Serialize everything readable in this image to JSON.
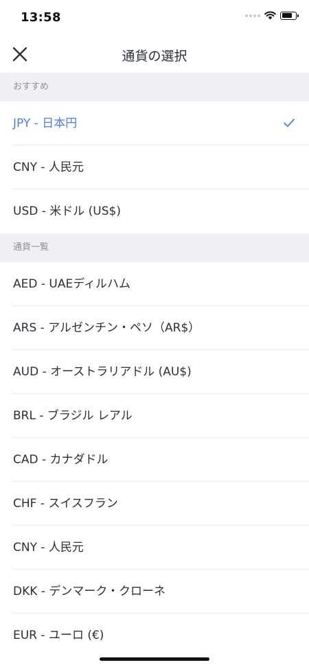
{
  "status_bar": {
    "time": "13:58",
    "battery_level": 0.8
  },
  "header": {
    "title": "通貨の選択",
    "close_icon": "close-icon"
  },
  "sections": [
    {
      "title": "おすすめ",
      "items": [
        {
          "label": "JPY - 日本円",
          "selected": true
        },
        {
          "label": "CNY - 人民元",
          "selected": false
        },
        {
          "label": "USD - 米ドル (US$)",
          "selected": false
        }
      ]
    },
    {
      "title": "通貨一覧",
      "items": [
        {
          "label": "AED - UAEディルハム"
        },
        {
          "label": "ARS - アルゼンチン・ペソ（AR$）"
        },
        {
          "label": "AUD - オーストラリアドル (AU$)"
        },
        {
          "label": "BRL - ブラジル レアル"
        },
        {
          "label": "CAD - カナダドル"
        },
        {
          "label": "CHF - スイスフラン"
        },
        {
          "label": "CNY - 人民元"
        },
        {
          "label": "DKK - デンマーク・クローネ"
        },
        {
          "label": "EUR - ユーロ (€)"
        }
      ]
    }
  ],
  "colors": {
    "accent": "#4e7ce8",
    "text": "#2b2f36",
    "section_bg": "#eff0f3"
  }
}
